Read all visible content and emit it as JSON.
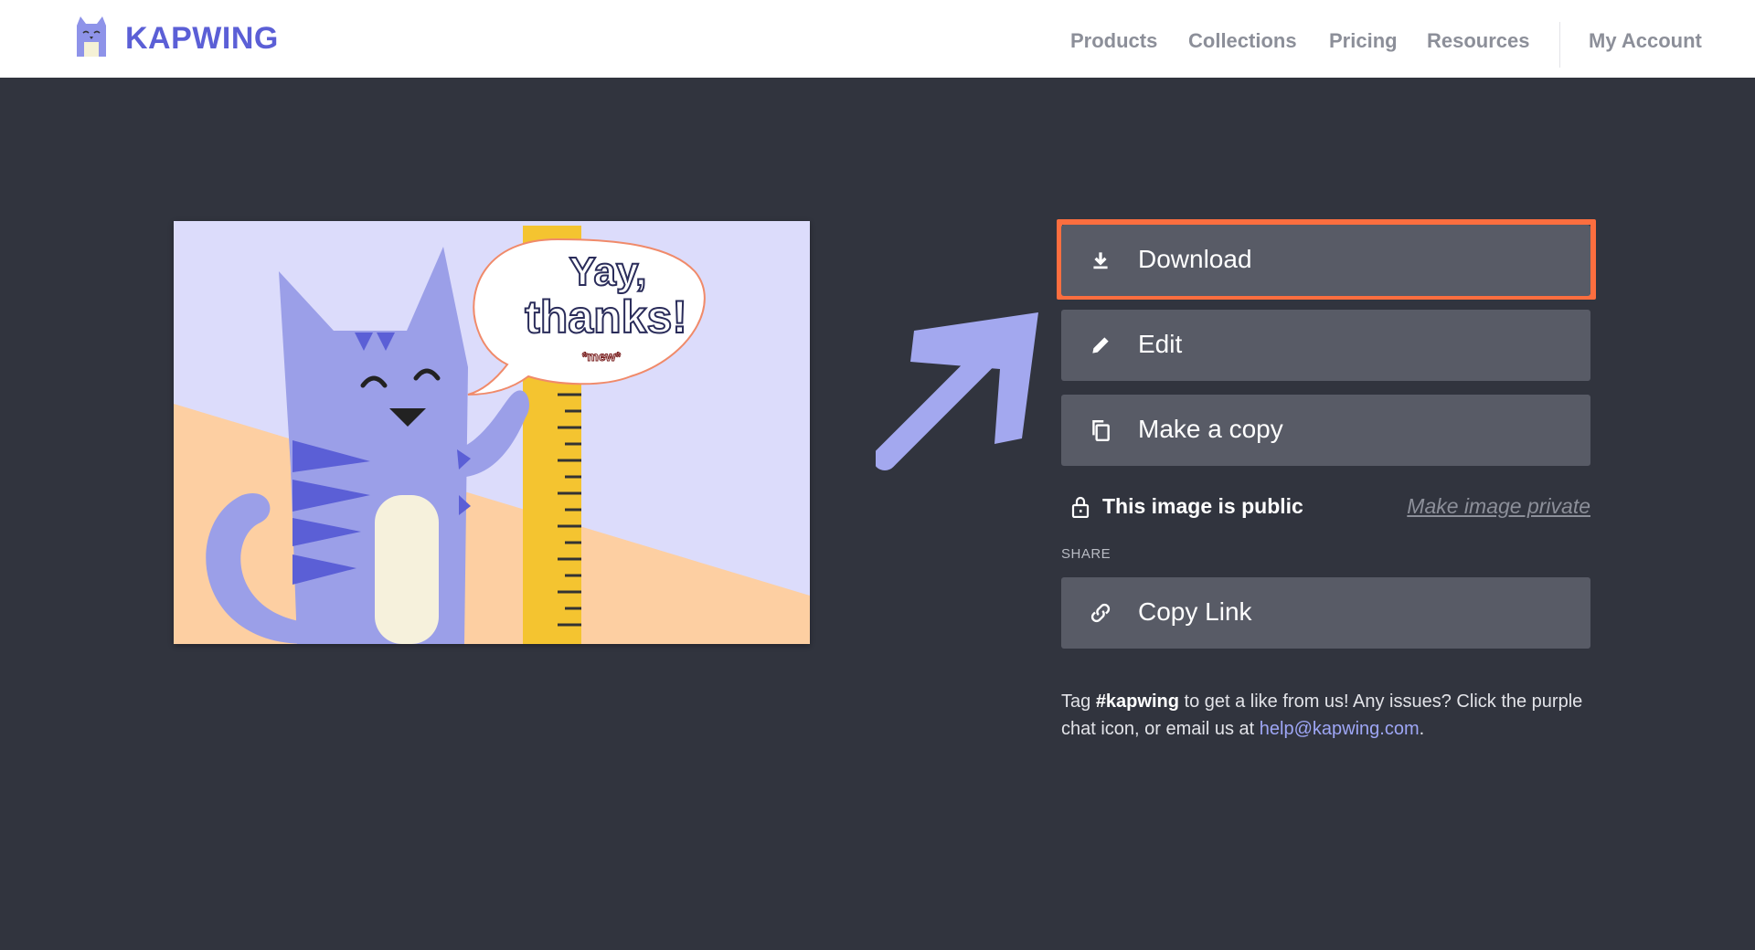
{
  "header": {
    "brand": "KAPWING",
    "nav": [
      "Products",
      "Collections",
      "Pricing",
      "Resources"
    ],
    "account": "My Account"
  },
  "preview": {
    "bubble_line1": "Yay,",
    "bubble_line2": "thanks!",
    "bubble_small": "*mew*"
  },
  "actions": {
    "download": "Download",
    "edit": "Edit",
    "copy": "Make a copy"
  },
  "privacy": {
    "status": "This image is public",
    "toggle": "Make image private"
  },
  "share": {
    "label": "SHARE",
    "copy_link": "Copy Link"
  },
  "info": {
    "tag_prefix": "Tag ",
    "hashtag": "#kapwing",
    "middle": " to get a like from us! Any issues? Click the purple chat icon, or email us at ",
    "email": "help@kapwing.com",
    "suffix": "."
  },
  "colors": {
    "brand": "#5b5fd6",
    "background": "#31343e",
    "button": "#585b66",
    "highlight": "#fc6e3f",
    "arrow": "#a3a8ef"
  }
}
